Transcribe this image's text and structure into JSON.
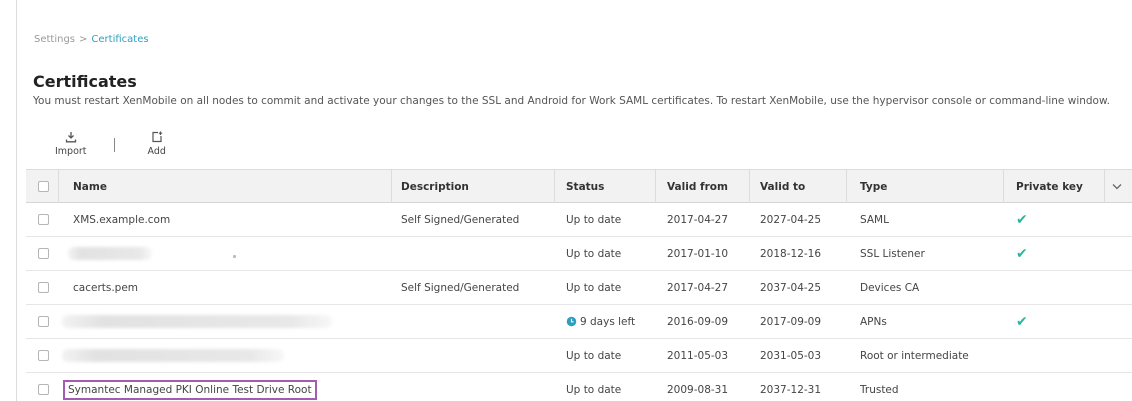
{
  "breadcrumb": {
    "parent": "Settings",
    "separator": ">",
    "current": "Certificates"
  },
  "page": {
    "title": "Certificates",
    "description": "You must restart XenMobile on all nodes to commit and activate your changes to the SSL and Android for Work SAML certificates. To restart XenMobile, use the hypervisor console or command-line window."
  },
  "toolbar": {
    "import_label": "Import",
    "add_label": "Add"
  },
  "table": {
    "columns": {
      "name": "Name",
      "description": "Description",
      "status": "Status",
      "valid_from": "Valid from",
      "valid_to": "Valid to",
      "type": "Type",
      "private_key": "Private key"
    },
    "rows": [
      {
        "name": "XMS.example.com",
        "description": "Self Signed/Generated",
        "status": "Up to date",
        "valid_from": "2017-04-27",
        "valid_to": "2027-04-25",
        "type": "SAML",
        "private_key": true
      },
      {
        "name": "",
        "description": "",
        "status": "Up to date",
        "valid_from": "2017-01-10",
        "valid_to": "2018-12-16",
        "type": "SSL Listener",
        "private_key": true
      },
      {
        "name": "cacerts.pem",
        "description": "Self Signed/Generated",
        "status": "Up to date",
        "valid_from": "2017-04-27",
        "valid_to": "2037-04-25",
        "type": "Devices CA",
        "private_key": false
      },
      {
        "name": "",
        "description": "",
        "status": "9 days left",
        "valid_from": "2016-09-09",
        "valid_to": "2017-09-09",
        "type": "APNs",
        "private_key": true
      },
      {
        "name": "",
        "description": "",
        "status": "Up to date",
        "valid_from": "2011-05-03",
        "valid_to": "2031-05-03",
        "type": "Root or intermediate",
        "private_key": false
      },
      {
        "name": "Symantec Managed PKI Online Test Drive Root",
        "description": "",
        "status": "Up to date",
        "valid_from": "2009-08-31",
        "valid_to": "2037-12-31",
        "type": "Trusted",
        "private_key": false
      }
    ]
  },
  "colors": {
    "accent": "#2f9fbf",
    "check": "#27b7a3",
    "highlight": "#a45bb3",
    "header_bg": "#f2f2f2"
  }
}
